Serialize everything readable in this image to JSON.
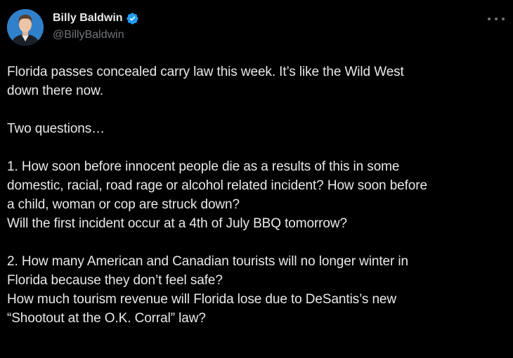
{
  "author": {
    "display_name": "Billy Baldwin",
    "handle": "@BillyBaldwin",
    "verified": true,
    "avatar_icon": "user-avatar",
    "verified_icon": "verified-badge-icon",
    "verified_color": "#1d9bf0"
  },
  "menu": {
    "icon": "more-options-icon"
  },
  "tweet": {
    "lines": [
      "Florida passes concealed carry law this week. It’s like the Wild West",
      "down there now.",
      "",
      "Two questions…",
      "",
      "1. How soon before innocent people die as a results of this in some",
      "domestic, racial, road rage or alcohol related incident? How soon before",
      "a child, woman or cop are struck down?",
      "Will the first incident occur at a 4th of July BBQ tomorrow?",
      "",
      "2. How many American and Canadian tourists will no longer winter in",
      "Florida because they don’t feel safe?",
      "How much tourism revenue will Florida lose due to DeSantis’s new",
      "“Shootout at the O.K. Corral” law?"
    ]
  },
  "colors": {
    "background": "#000000",
    "text_primary": "#e7e9ea",
    "text_secondary": "#71767b"
  }
}
